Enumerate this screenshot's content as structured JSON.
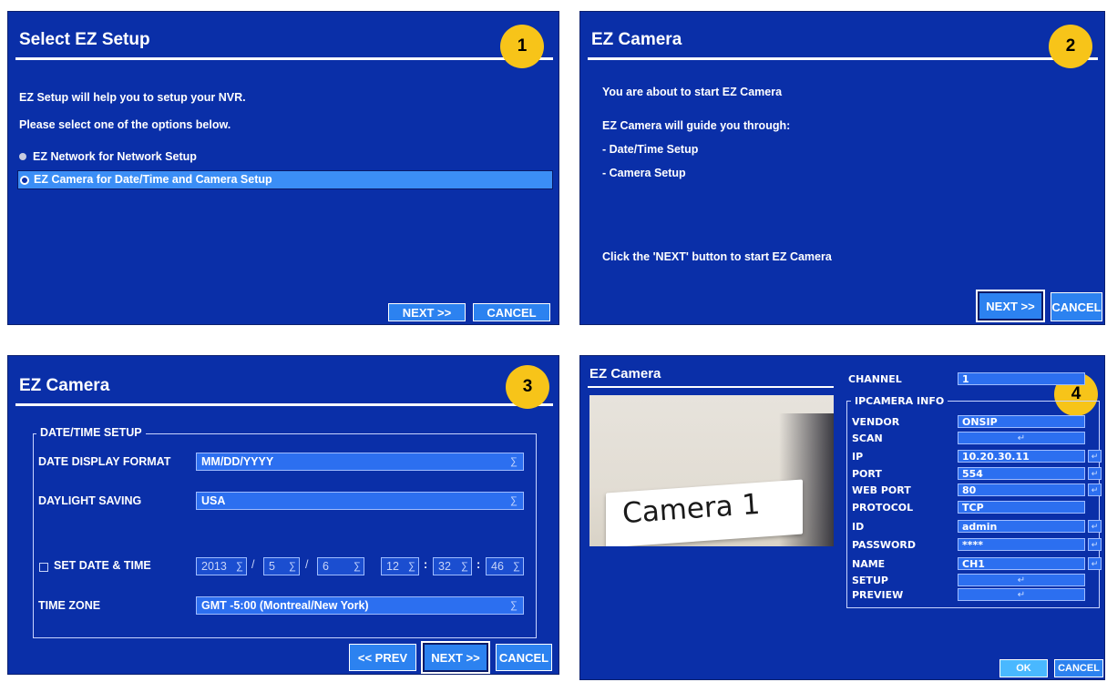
{
  "panel1": {
    "title": "Select EZ Setup",
    "badge": "1",
    "line1": "EZ Setup will help you to setup your NVR.",
    "line2": "Please select one of the options below.",
    "options": [
      "EZ Network for Network Setup",
      "EZ Camera for Date/Time and Camera Setup"
    ],
    "next": "NEXT >>",
    "cancel": "CANCEL"
  },
  "panel2": {
    "title": "EZ Camera",
    "badge": "2",
    "lines": [
      "You are about to start EZ Camera",
      "EZ Camera will guide you through:",
      "- Date/Time Setup",
      "- Camera Setup"
    ],
    "footer": "Click the 'NEXT' button to start EZ Camera",
    "next": "NEXT >>",
    "cancel": "CANCEL"
  },
  "panel3": {
    "title": "EZ Camera",
    "badge": "3",
    "group": "DATE/TIME SETUP",
    "date_format_label": "DATE DISPLAY FORMAT",
    "date_format_value": "MM/DD/YYYY",
    "daylight_label": "DAYLIGHT SAVING",
    "daylight_value": "USA",
    "set_dt_label": "SET DATE & TIME",
    "year": "2013",
    "month": "5",
    "day": "6",
    "hour": "12",
    "minute": "32",
    "second": "46",
    "slash": "/",
    "colon": ":",
    "timezone_label": "TIME ZONE",
    "timezone_value": "GMT -5:00 (Montreal/New York)",
    "drop_glyph": "∑",
    "prev": "<< PREV",
    "next": "NEXT >>",
    "cancel": "CANCEL"
  },
  "panel4": {
    "title": "EZ Camera",
    "badge": "4",
    "camera_text": "Camera 1",
    "channel_label": "CHANNEL",
    "channel_value": "1",
    "group": "IPCAMERA INFO",
    "vendor_label": "VENDOR",
    "vendor_value": "ONSIP",
    "scan_label": "SCAN",
    "ip_label": "IP",
    "ip_value": "10.20.30.11",
    "port_label": "PORT",
    "port_value": "554",
    "webport_label": "WEB PORT",
    "webport_value": "80",
    "protocol_label": "PROTOCOL",
    "protocol_value": "TCP",
    "id_label": "ID",
    "id_value": "admin",
    "password_label": "PASSWORD",
    "password_value": "****",
    "name_label": "NAME",
    "name_value": "CH1",
    "setup_label": "SETUP",
    "preview_label": "PREVIEW",
    "enter_glyph": "↵",
    "ok": "OK",
    "cancel": "CANCEL"
  },
  "colors": {
    "panel_bg": "#0a2fa8",
    "button": "#2c82f0",
    "field": "#2c6ff0",
    "badge": "#f7c419",
    "ok_button": "#49b8ff"
  }
}
